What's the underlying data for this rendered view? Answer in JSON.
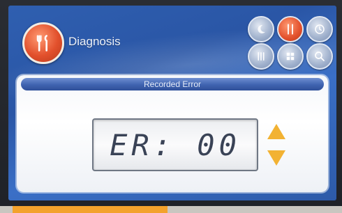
{
  "header": {
    "title": "Diagnosis"
  },
  "panel": {
    "title": "Recorded Error",
    "display": "ER: 00"
  },
  "toolbar": {
    "buttons": [
      {
        "icon": "moon-icon",
        "active": false
      },
      {
        "icon": "tools-icon",
        "active": true
      },
      {
        "icon": "clock-icon",
        "active": false
      },
      {
        "icon": "settings-icon",
        "active": false
      },
      {
        "icon": "grid-icon",
        "active": false
      },
      {
        "icon": "search-icon",
        "active": false
      }
    ]
  },
  "colors": {
    "screen": "#2f5fb0",
    "accent": "#e2502c",
    "arrow": "#f2b233",
    "strip": "#f3a22c"
  }
}
